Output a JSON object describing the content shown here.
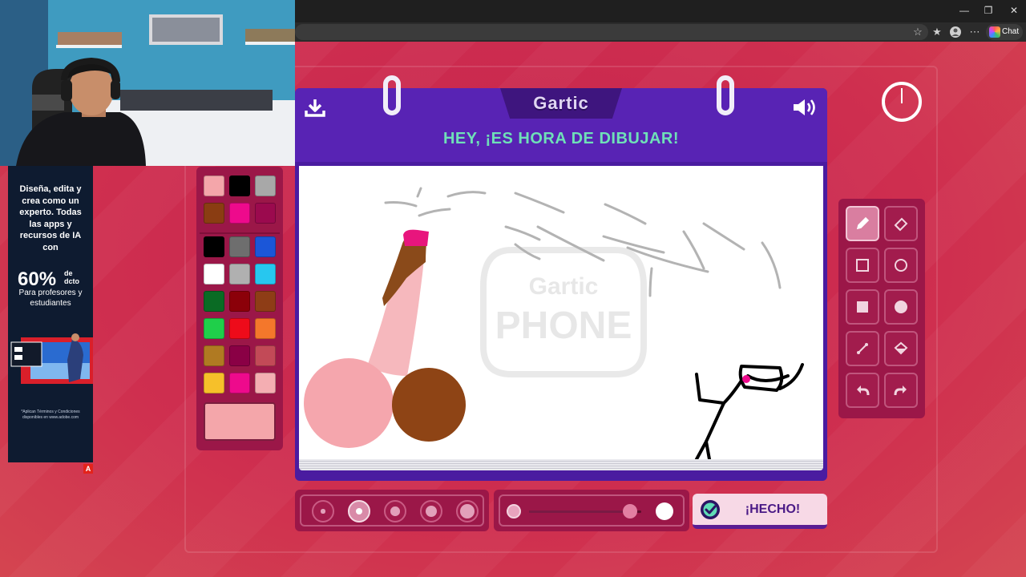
{
  "browser": {
    "chat_label": "Chat",
    "window_controls": [
      "minimize-icon",
      "restore-icon",
      "close-icon"
    ],
    "toolbar_icons": [
      "star-icon",
      "favorites-icon",
      "profile-icon",
      "more-icon"
    ]
  },
  "ad": {
    "headline": "Diseña, edita y crea como un experto. Todas las apps y recursos de IA con",
    "discount": "60%",
    "discount_suffix_1": "de",
    "discount_suffix_2": "dcto",
    "subtext": "Para profesores y estudiantes",
    "fine_print": "*Aplican Términos y Condiciones disponibles en www.adobe.com",
    "logo_letter": "A"
  },
  "game": {
    "logo": "Gartic",
    "watermark_line1": "Gartic",
    "watermark_line2": "PHONE",
    "title": "HEY, ¡ES HORA DE DIBUJAR!",
    "done_label": "¡HECHO!",
    "palette_colors": [
      "#f4a6aa",
      "#000000",
      "#a8a8a8",
      "#8a3d12",
      "#ee0a8c",
      "#9b0a4e",
      "#000000",
      "#6e6e6e",
      "#1b56d8",
      "#ffffff",
      "#b0b0b0",
      "#27c7ef",
      "#0a6b24",
      "#8b0009",
      "#8e3d16",
      "#1fcf4a",
      "#ee0b1a",
      "#f4772b",
      "#b07a22",
      "#8a0045",
      "#c24a57",
      "#f6c02a",
      "#ee0a8c",
      "#f4aeb2"
    ],
    "current_color": "#f4a6aa",
    "tools": [
      {
        "name": "pencil-tool",
        "icon": "pencil-icon",
        "active": true
      },
      {
        "name": "eraser-tool",
        "icon": "eraser-icon",
        "active": false
      },
      {
        "name": "rectangle-tool",
        "icon": "square-outline-icon",
        "active": false
      },
      {
        "name": "ellipse-tool",
        "icon": "circle-outline-icon",
        "active": false
      },
      {
        "name": "filled-rectangle-tool",
        "icon": "square-filled-icon",
        "active": false
      },
      {
        "name": "filled-ellipse-tool",
        "icon": "circle-filled-icon",
        "active": false
      },
      {
        "name": "line-tool",
        "icon": "line-icon",
        "active": false
      },
      {
        "name": "fill-tool",
        "icon": "paint-bucket-icon",
        "active": false
      },
      {
        "name": "undo-tool",
        "icon": "undo-icon",
        "active": false
      },
      {
        "name": "redo-tool",
        "icon": "redo-icon",
        "active": false
      }
    ],
    "brush_sizes": [
      1,
      2,
      3,
      4,
      5
    ],
    "selected_brush_size": 2,
    "opacity_fraction": 0.9
  }
}
